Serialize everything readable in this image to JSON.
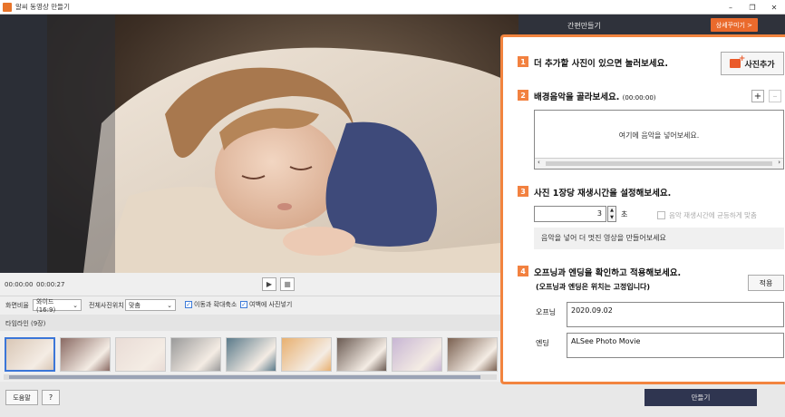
{
  "window": {
    "title": "알씨 동영상 만들기",
    "controls": [
      "–",
      "❐",
      "✕"
    ]
  },
  "header": {
    "mode_label": "간편만들기",
    "detail_button": "상세꾸미기 >"
  },
  "player": {
    "current_time": "00:00:00",
    "total_time": "00:00:27",
    "play_glyph": "▶",
    "stop_glyph": "■"
  },
  "options": {
    "ratio_label": "화면비율",
    "ratio_value": "와이드 (16:9)",
    "position_label": "전체사진위치",
    "position_value": "맞춤",
    "zoom_label": "이동과 확대축소",
    "blur_label": "여백에 사진넣기"
  },
  "timeline": {
    "label": "타임라인 (9장)",
    "thumbnails": [
      {
        "name": "thumb-1",
        "color": "#d9c7b6"
      },
      {
        "name": "thumb-2",
        "color": "#8a6a63"
      },
      {
        "name": "thumb-3",
        "color": "#e9dcd6"
      },
      {
        "name": "thumb-4",
        "color": "#9a9a9a"
      },
      {
        "name": "thumb-5",
        "color": "#5a7a8a"
      },
      {
        "name": "thumb-6",
        "color": "#e8b070"
      },
      {
        "name": "thumb-7",
        "color": "#6a5a52"
      },
      {
        "name": "thumb-8",
        "color": "#c8b6d4"
      },
      {
        "name": "thumb-9",
        "color": "#7a6050"
      }
    ]
  },
  "footer": {
    "help_button": "도움말",
    "question_button": "?",
    "make_button": "만들기"
  },
  "panel": {
    "step1": {
      "num": "1",
      "text": "더 추가할 사진이 있으면 눌러보세요."
    },
    "add_photo_button": "사진추가",
    "step2": {
      "num": "2",
      "text": "배경음악을 골라보세요.",
      "time": "(00:00:00)"
    },
    "music_add": "+",
    "music_remove": "–",
    "music_hint": "여기에 음악을 넣어보세요.",
    "step3": {
      "num": "3",
      "text": "사진 1장당 재생시간을 설정해보세요."
    },
    "seconds_value": "3",
    "seconds_unit": "초",
    "sync_label": "음악 재생시간에 균등하게 맞춤",
    "tip": "음악을 넣어 더 멋진 영상을 만들어보세요",
    "step4": {
      "num": "4",
      "text": "오프닝과 엔딩을 확인하고 적용해보세요.",
      "sub": "(오프닝과 엔딩은 위치는 고정입니다)"
    },
    "apply_button": "적용",
    "opening_label": "오프닝",
    "opening_value": "2020.09.02",
    "ending_label": "엔딩",
    "ending_value": "ALSee Photo Movie"
  }
}
